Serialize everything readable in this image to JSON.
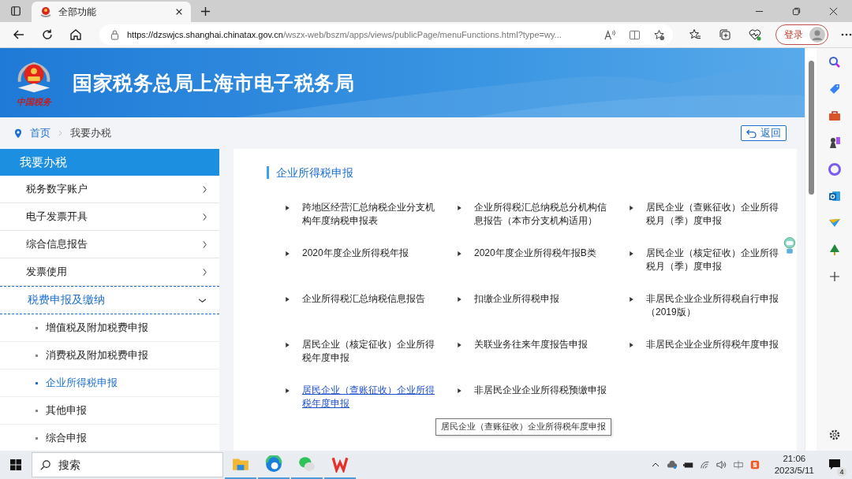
{
  "browser": {
    "tabs": [
      {
        "title": "全部功能",
        "selected": true
      }
    ],
    "url_host": "https://dzswjcs.shanghai.chinatax.gov.cn",
    "url_path": "/wszx-web/bszm/apps/views/publicPage/menuFunctions.html?type=wy...",
    "login_button": "登录"
  },
  "header": {
    "logo_caption": "中国税务",
    "title": "国家税务总局上海市电子税务局"
  },
  "breadcrumb": {
    "items": [
      "首页",
      "我要办税"
    ],
    "back_button": "返回"
  },
  "sidebar": {
    "title": "我要办税",
    "items": [
      {
        "label": "税务数字账户",
        "expanded": false
      },
      {
        "label": "电子发票开具",
        "expanded": false
      },
      {
        "label": "综合信息报告",
        "expanded": false
      },
      {
        "label": "发票使用",
        "expanded": false
      },
      {
        "label": "税费申报及缴纳",
        "expanded": true,
        "children": [
          {
            "label": "增值税及附加税费申报",
            "selected": false
          },
          {
            "label": "消费税及附加税费申报",
            "selected": false
          },
          {
            "label": "企业所得税申报",
            "selected": true
          },
          {
            "label": "其他申报",
            "selected": false
          },
          {
            "label": "综合申报",
            "selected": false
          }
        ]
      }
    ]
  },
  "main": {
    "section_title": "企业所得税申报",
    "functions": [
      {
        "label": "跨地区经营汇总纳税企业分支机构年度纳税申报表",
        "hovered": false
      },
      {
        "label": "企业所得税汇总纳税总分机构信息报告（本市分支机构适用）",
        "hovered": false
      },
      {
        "label": "居民企业（查账征收）企业所得税月（季）度申报",
        "hovered": false
      },
      {
        "label": "2020年度企业所得税年报",
        "hovered": false
      },
      {
        "label": "2020年度企业所得税年报B类",
        "hovered": false
      },
      {
        "label": "居民企业（核定征收）企业所得税月（季）度申报",
        "hovered": false
      },
      {
        "label": "企业所得税汇总纳税信息报告",
        "hovered": false
      },
      {
        "label": "扣缴企业所得税申报",
        "hovered": false
      },
      {
        "label": "非居民企业企业所得税自行申报（2019版）",
        "hovered": false
      },
      {
        "label": "居民企业（核定征收）企业所得税年度申报",
        "hovered": false
      },
      {
        "label": "关联业务往来年度报告申报",
        "hovered": false
      },
      {
        "label": "非居民企业企业所得税年度申报",
        "hovered": false
      },
      {
        "label": "居民企业（查账征收）企业所得税年度申报",
        "hovered": true
      },
      {
        "label": "非居民企业企业所得税预缴申报",
        "hovered": false
      }
    ],
    "tooltip": "居民企业（查账征收）企业所得税年度申报"
  },
  "taskbar": {
    "search_placeholder": "搜索",
    "time": "21:06",
    "date": "2023/5/11",
    "notification_count": "4"
  }
}
